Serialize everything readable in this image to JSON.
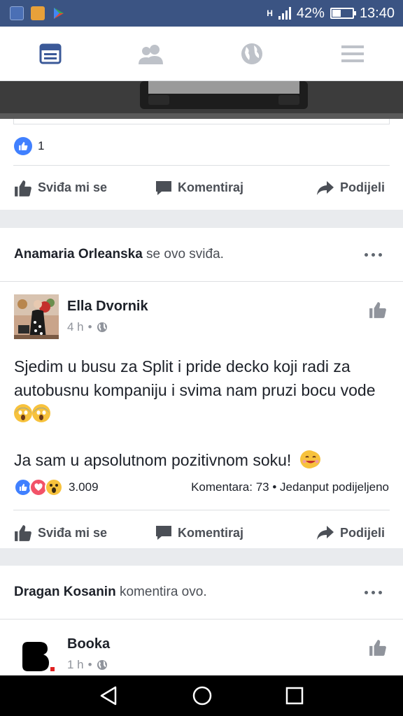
{
  "status_bar": {
    "signal_label": "H",
    "battery_percent": "42%",
    "time": "13:40",
    "battery_level": 0.42
  },
  "top_nav": {
    "tabs": [
      {
        "icon": "news-feed-icon",
        "active": true
      },
      {
        "icon": "friends-icon",
        "active": false
      },
      {
        "icon": "globe-icon",
        "active": false
      },
      {
        "icon": "menu-icon",
        "active": false
      }
    ]
  },
  "first_post": {
    "like_count": "1",
    "actions": {
      "like": "Sviđa mi se",
      "comment": "Komentiraj",
      "share": "Podijeli"
    }
  },
  "second_story": {
    "actor": "Anamaria Orleanska",
    "activity": " se ovo sviđa.",
    "post": {
      "author": "Ella Dvornik",
      "time": "4 h",
      "text_line1": "Sjedim u busu za Split i pride decko koji radi za autobusnu kompaniju i svima nam pruzi bocu vode",
      "text_line2": "Ja sam u apsolutnom pozitivnom soku!",
      "reaction_count": "3.009",
      "comments_summary": "Komentara: 73",
      "shares_summary": "Jedanput podijeljeno",
      "actions": {
        "like": "Sviđa mi se",
        "comment": "Komentiraj",
        "share": "Podijeli"
      }
    }
  },
  "third_story": {
    "actor": "Dragan Kosanin",
    "activity": " komentira ovo.",
    "post": {
      "author": "Booka",
      "time": "1 h"
    }
  },
  "colors": {
    "brand_blue": "#3b5998",
    "status_bar": "#3b5483",
    "like_blue": "#4080ff",
    "love_red": "#f25268",
    "wow_yellow": "#f7c23c"
  }
}
